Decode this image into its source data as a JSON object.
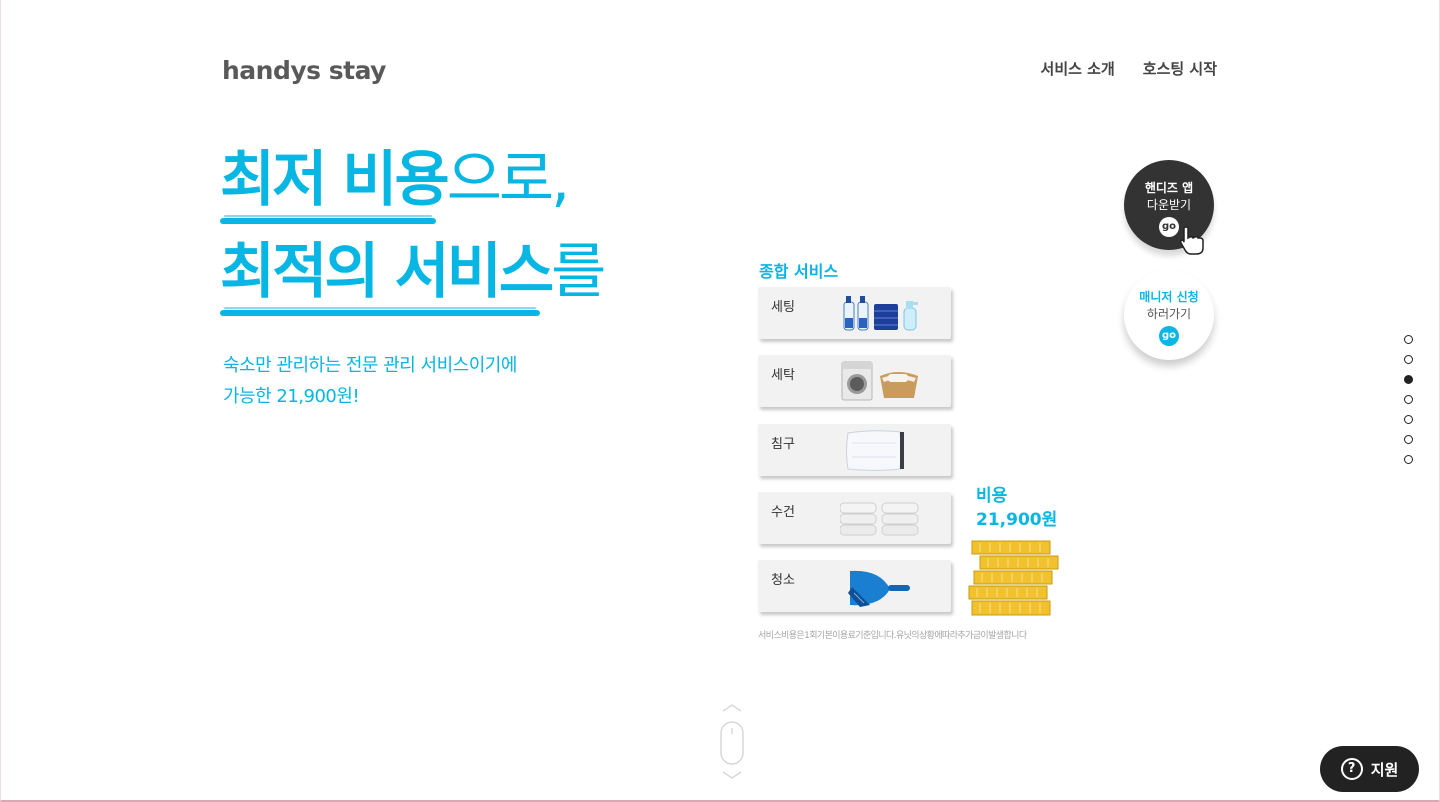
{
  "brand": {
    "logo_text": "handys stay"
  },
  "nav": {
    "items": [
      "서비스 소개",
      "호스팅 시작"
    ]
  },
  "hero": {
    "line1_strong": "최저 비용",
    "line1_light": "으로,",
    "line2_strong": "최적의 서비스",
    "line2_light": "를",
    "sub_line1": "숙소만 관리하는 전문 관리 서비스이기에",
    "sub_line2": "가능한 21,900원!"
  },
  "services": {
    "title": "종합 서비스",
    "items": [
      {
        "label": "세팅",
        "icon": "cleaning-bottles-icon"
      },
      {
        "label": "세탁",
        "icon": "washing-machine-icon"
      },
      {
        "label": "침구",
        "icon": "pillow-icon"
      },
      {
        "label": "수건",
        "icon": "towels-icon"
      },
      {
        "label": "청소",
        "icon": "dustpan-icon"
      }
    ],
    "cost_label": "비용",
    "cost_value": "21,900원",
    "note": "서비스비용은1회기본이용료기준입니다.유닛의상황에따라추가금이발생합니다"
  },
  "cta": {
    "app": {
      "title": "핸디즈 앱",
      "sub": "다운받기",
      "go": "go"
    },
    "manager": {
      "title": "매니저 신청",
      "sub": "하러가기",
      "go": "go"
    }
  },
  "pagination": {
    "count": 7,
    "active_index": 2
  },
  "support": {
    "label": "지원",
    "icon": "question-icon"
  },
  "colors": {
    "accent": "#08b6e3",
    "dark": "#333333",
    "coin": "#f2c12e"
  }
}
